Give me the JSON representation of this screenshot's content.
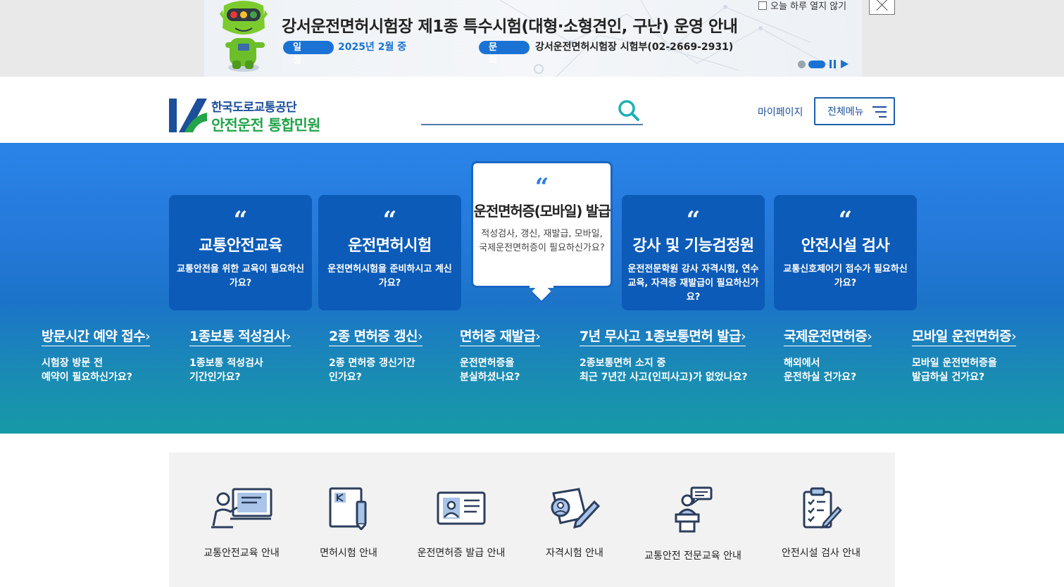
{
  "banner": {
    "title": "강서운전면허시험장 제1종 특수시험(대형·소형견인, 구난) 운영 안내",
    "schedule_label": "일 정",
    "schedule_value": "2025년 2월 중",
    "contact_label": "문 의",
    "contact_value": "강서운전면허시험장 시험부(02-2669-2931)",
    "dont_show_today": "오늘 하루 열지 않기"
  },
  "header": {
    "logo_org": "한국도로교통공단",
    "logo_name": "안전운전 통합민원",
    "search_placeholder": "",
    "mypage": "마이페이지",
    "all_menu": "전체메뉴"
  },
  "cards": [
    {
      "quote": "“",
      "title": "교통안전교육",
      "desc": "교통안전을 위한 교육이 필요하신가요?"
    },
    {
      "quote": "“",
      "title": "운전면허시험",
      "desc": "운전면허시험을 준비하시고 계신가요?"
    },
    {
      "quote": "“",
      "title": "운전면허증(모바일) 발급",
      "desc": "적성검사, 갱신, 재발급, 모바일, 국제운전면허증이 필요하신가요?",
      "active": true
    },
    {
      "quote": "“",
      "title": "강사 및 기능검정원",
      "desc": "운전전문학원 강사 자격시험, 연수교육, 자격증 재발급이 필요하신가요?"
    },
    {
      "quote": "“",
      "title": "안전시설 검사",
      "desc": "교통신호제어기 접수가 필요하신가요?"
    }
  ],
  "quick_links": [
    {
      "title": "방문시간 예약 접수",
      "line1": "시험장 방문 전",
      "line2": "예약이 필요하신가요?"
    },
    {
      "title": "1종보통 적성검사",
      "line1": "1종보통 적성검사",
      "line2": "기간인가요?"
    },
    {
      "title": "2종 면허증 갱신",
      "line1": "2종 면허증 갱신기간",
      "line2": "인가요?"
    },
    {
      "title": "면허증 재발급",
      "line1": "운전면허증을",
      "line2": "분실하셨나요?"
    },
    {
      "title": "7년 무사고 1종보통면허 발급",
      "line1": "2종보통면허 소지 중",
      "line2": "최근 7년간 사고(인피사고)가 없었나요?"
    },
    {
      "title": "국제운전면허증",
      "line1": "해외에서",
      "line2": "운전하실 건가요?"
    },
    {
      "title": "모바일 운전면허증",
      "line1": "모바일 운전면허증을",
      "line2": "발급하실 건가요?"
    }
  ],
  "arrow": "›",
  "services": [
    {
      "label": "교통안전교육 안내",
      "icon": "teacher-board-icon"
    },
    {
      "label": "면허시험 안내",
      "icon": "license-book-icon"
    },
    {
      "label": "운전면허증 발급 안내",
      "icon": "id-card-icon"
    },
    {
      "label": "자격시험 안내",
      "icon": "certificate-pen-icon"
    },
    {
      "label": "교통안전 전문교육 안내",
      "icon": "speaker-podium-icon"
    },
    {
      "label": "안전시설 검사 안내",
      "icon": "checklist-icon"
    }
  ],
  "colors": {
    "brand_blue": "#1c4e9a",
    "brand_green": "#22a44a",
    "hero_top": "#2a84e8",
    "hero_bottom": "#169aa6",
    "card_bg": "#0c5bb8",
    "accent": "#1a73d4"
  }
}
